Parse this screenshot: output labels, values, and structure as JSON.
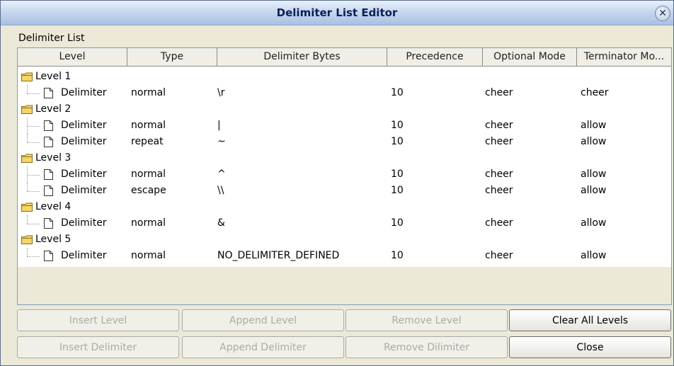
{
  "window": {
    "title": "Delimiter List Editor",
    "close_symbol": "✕"
  },
  "section_label": "Delimiter List",
  "columns": [
    "Level",
    "Type",
    "Delimiter Bytes",
    "Precedence",
    "Optional Mode",
    "Terminator Mo..."
  ],
  "levels": [
    {
      "label": "Level 1",
      "delimiters": [
        {
          "name": "Delimiter",
          "type": "normal",
          "bytes": "\\r",
          "precedence": "10",
          "optional": "cheer",
          "terminator": "cheer"
        }
      ]
    },
    {
      "label": "Level 2",
      "delimiters": [
        {
          "name": "Delimiter",
          "type": "normal",
          "bytes": "|",
          "precedence": "10",
          "optional": "cheer",
          "terminator": "allow"
        },
        {
          "name": "Delimiter",
          "type": "repeat",
          "bytes": "~",
          "precedence": "10",
          "optional": "cheer",
          "terminator": "allow"
        }
      ]
    },
    {
      "label": "Level 3",
      "delimiters": [
        {
          "name": "Delimiter",
          "type": "normal",
          "bytes": "^",
          "precedence": "10",
          "optional": "cheer",
          "terminator": "allow"
        },
        {
          "name": "Delimiter",
          "type": "escape",
          "bytes": "\\\\",
          "precedence": "10",
          "optional": "cheer",
          "terminator": "allow"
        }
      ]
    },
    {
      "label": "Level 4",
      "delimiters": [
        {
          "name": "Delimiter",
          "type": "normal",
          "bytes": "&",
          "precedence": "10",
          "optional": "cheer",
          "terminator": "allow"
        }
      ]
    },
    {
      "label": "Level 5",
      "delimiters": [
        {
          "name": "Delimiter",
          "type": "normal",
          "bytes": "NO_DELIMITER_DEFINED",
          "precedence": "10",
          "optional": "cheer",
          "terminator": "allow"
        }
      ]
    }
  ],
  "buttons": {
    "insert_level": "Insert Level",
    "append_level": "Append Level",
    "remove_level": "Remove Level",
    "clear_all_levels": "Clear All Levels",
    "insert_delimiter": "Insert Delimiter",
    "append_delimiter": "Append Delimiter",
    "remove_delimiter": "Remove Dilimiter",
    "close": "Close"
  },
  "icons": {
    "folder": "folder-icon",
    "document": "document-icon"
  },
  "colors": {
    "title_text": "#0a1f5c",
    "folder_fill": "#f3d56b",
    "window_bg": "#ece9d8"
  }
}
